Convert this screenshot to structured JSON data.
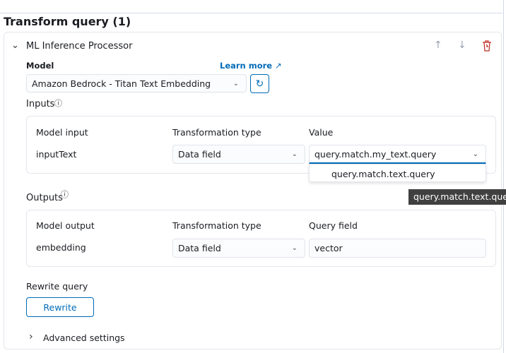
{
  "section_title": "Transform query (1)",
  "processor": {
    "title": "ML Inference Processor",
    "model_label": "Model",
    "learn_more": "Learn more",
    "model_value": "Amazon Bedrock - Titan Text Embedding",
    "inputs_label": "Inputs",
    "inputs": {
      "headers": [
        "Model input",
        "Transformation type",
        "Value"
      ],
      "row": {
        "model_input": "inputText",
        "transformation_type": "Data field",
        "value": "query.match.my_text.query"
      },
      "dropdown_option": "query.match.text.query",
      "tooltip": "query.match.text.query"
    },
    "outputs_label": "Outputs",
    "outputs": {
      "headers": [
        "Model output",
        "Transformation type",
        "Query field"
      ],
      "row": {
        "model_output": "embedding",
        "transformation_type": "Data field",
        "query_field": "vector"
      }
    },
    "rewrite_label": "Rewrite query",
    "rewrite_button": "Rewrite",
    "advanced_settings": "Advanced settings"
  },
  "colors": {
    "accent": "#006bb8",
    "danger": "#bd271e",
    "tooltip_bg": "#404040"
  }
}
